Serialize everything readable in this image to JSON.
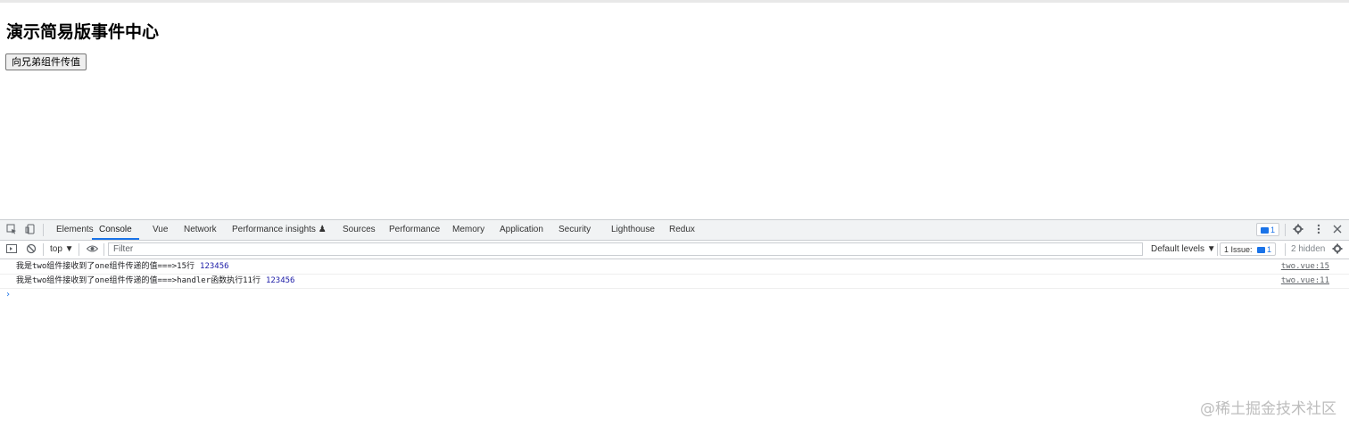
{
  "page": {
    "heading": "演示简易版事件中心",
    "button_label": "向兄弟组件传值"
  },
  "devtools": {
    "tabs": [
      {
        "label": "Elements"
      },
      {
        "label": "Console"
      },
      {
        "label": "Vue"
      },
      {
        "label": "Network"
      },
      {
        "label": "Performance insights ♟"
      },
      {
        "label": "Sources"
      },
      {
        "label": "Performance"
      },
      {
        "label": "Memory"
      },
      {
        "label": "Application"
      },
      {
        "label": "Security"
      },
      {
        "label": "Lighthouse"
      },
      {
        "label": "Redux"
      }
    ],
    "active_tab": "Console",
    "issues_badge_count": "1",
    "toolbar": {
      "context": "top ▼",
      "filter_placeholder": "Filter",
      "default_levels": "Default levels ▼",
      "issues_label": "1 Issue:",
      "issues_count": "1",
      "hidden": "2 hidden"
    },
    "console_rows": [
      {
        "message": "我是two组件接收到了one组件传递的值===>15行",
        "value": "123456",
        "source": "two.vue:15"
      },
      {
        "message": "我是two组件接收到了one组件传递的值===>handler函数执行11行",
        "value": "123456",
        "source": "two.vue:11"
      }
    ],
    "prompt": "›"
  },
  "watermark": "@稀土掘金技术社区",
  "colors": {
    "accent": "#1a73e8",
    "tabbar_bg": "#f1f3f4",
    "number_blue": "#1a1aa6"
  }
}
